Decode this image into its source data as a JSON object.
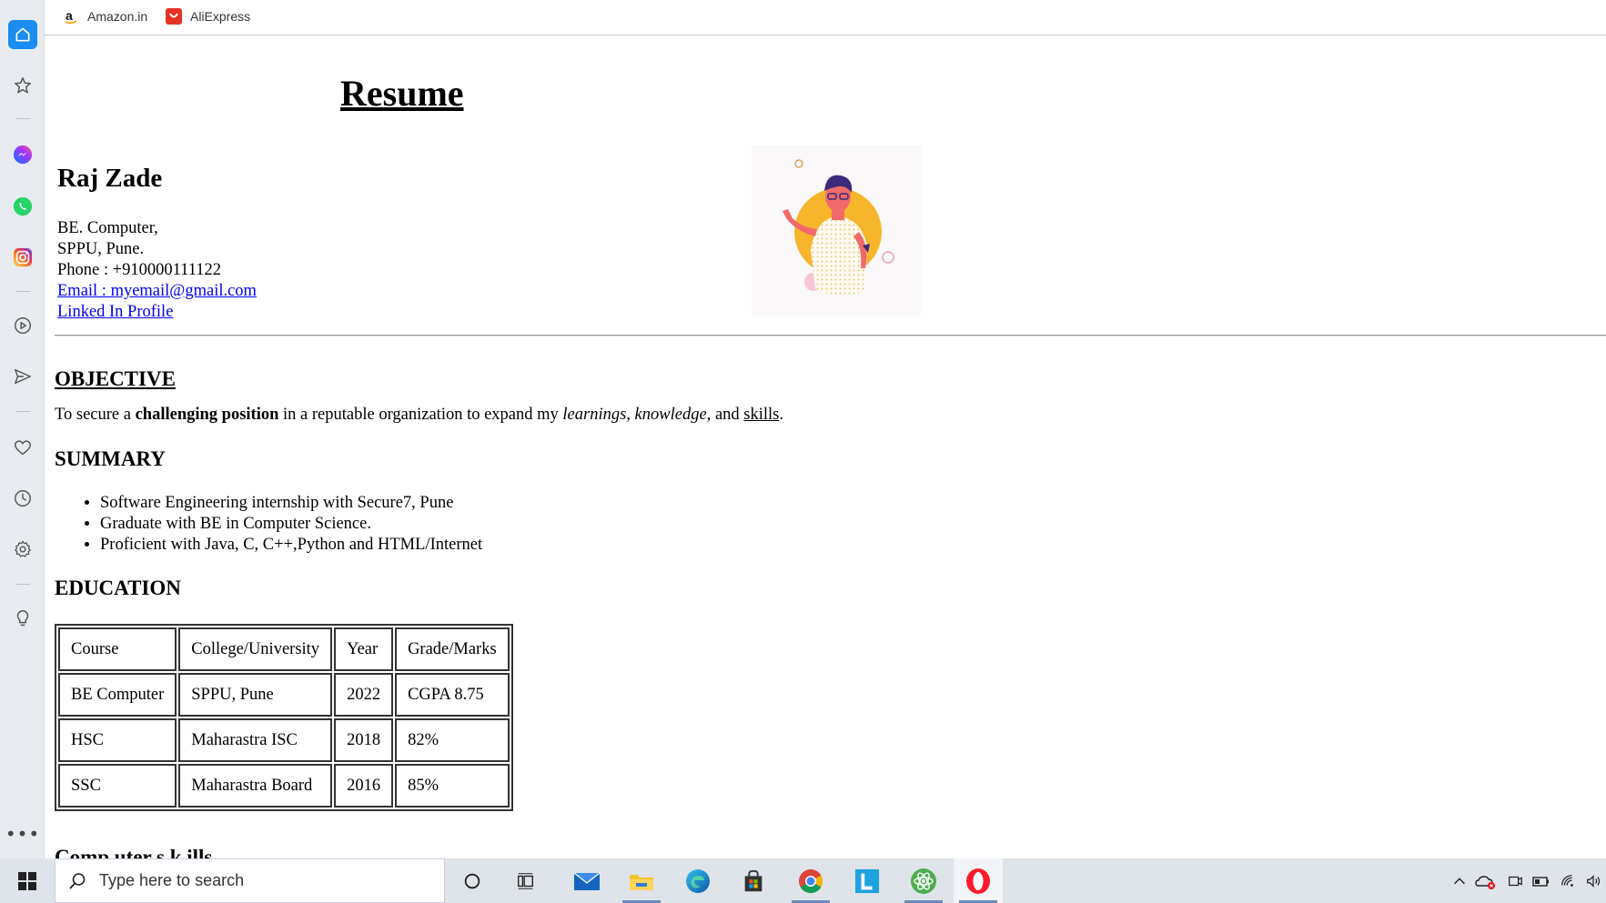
{
  "bookmarks": [
    {
      "label": "Amazon.in",
      "icon": "amazon-icon"
    },
    {
      "label": "AliExpress",
      "icon": "aliexpress-icon"
    }
  ],
  "sidebar": {
    "icons": [
      "home-icon",
      "star-icon",
      "messenger-icon",
      "whatsapp-icon",
      "instagram-icon",
      "play-icon",
      "send-icon",
      "heart-icon",
      "history-icon",
      "settings-icon",
      "lightbulb-icon",
      "more-icon"
    ],
    "more_label": "•••"
  },
  "resume": {
    "title": "Resume",
    "name": "Raj Zade",
    "degree": "BE. Computer,",
    "university": "SPPU, Pune.",
    "phone": "Phone : +910000111122",
    "email": "Email : myemail@gmail.com",
    "linkedin": "Linked In Profile",
    "objective_heading": "OBJECTIVE",
    "objective": {
      "part1": "To secure a ",
      "bold": "challenging position",
      "part2": " in a reputable organization to expand my ",
      "italic": "learnings, knowledge,",
      "part3": " and ",
      "underline": "skills",
      "part4": "."
    },
    "summary_heading": "SUMMARY",
    "summary": [
      "Software Engineering internship with Secure7, Pune",
      "Graduate with BE in Computer Science.",
      "Proficient with Java, C, C++,Python and HTML/Internet"
    ],
    "education_heading": "EDUCATION",
    "education": {
      "headers": [
        "Course",
        "College/University",
        "Year",
        "Grade/Marks"
      ],
      "rows": [
        [
          "BE Computer",
          "SPPU, Pune",
          "2022",
          "CGPA 8.75"
        ],
        [
          "HSC",
          "Maharastra ISC",
          "2018",
          "82%"
        ],
        [
          "SSC",
          "Maharastra Board",
          "2016",
          "85%"
        ]
      ]
    },
    "next_heading_partial": "Comp uter s k ills"
  },
  "taskbar": {
    "search_placeholder": "Type here to search",
    "apps": [
      "cortana-icon",
      "task-view-icon",
      "mail-icon",
      "file-explorer-icon",
      "edge-icon",
      "store-icon",
      "chrome-icon",
      "l-app-icon",
      "atom-icon",
      "opera-icon"
    ],
    "tray": [
      "chevron-up-icon",
      "onedrive-icon",
      "meet-now-icon",
      "battery-icon",
      "wifi-icon",
      "volume-icon"
    ]
  }
}
